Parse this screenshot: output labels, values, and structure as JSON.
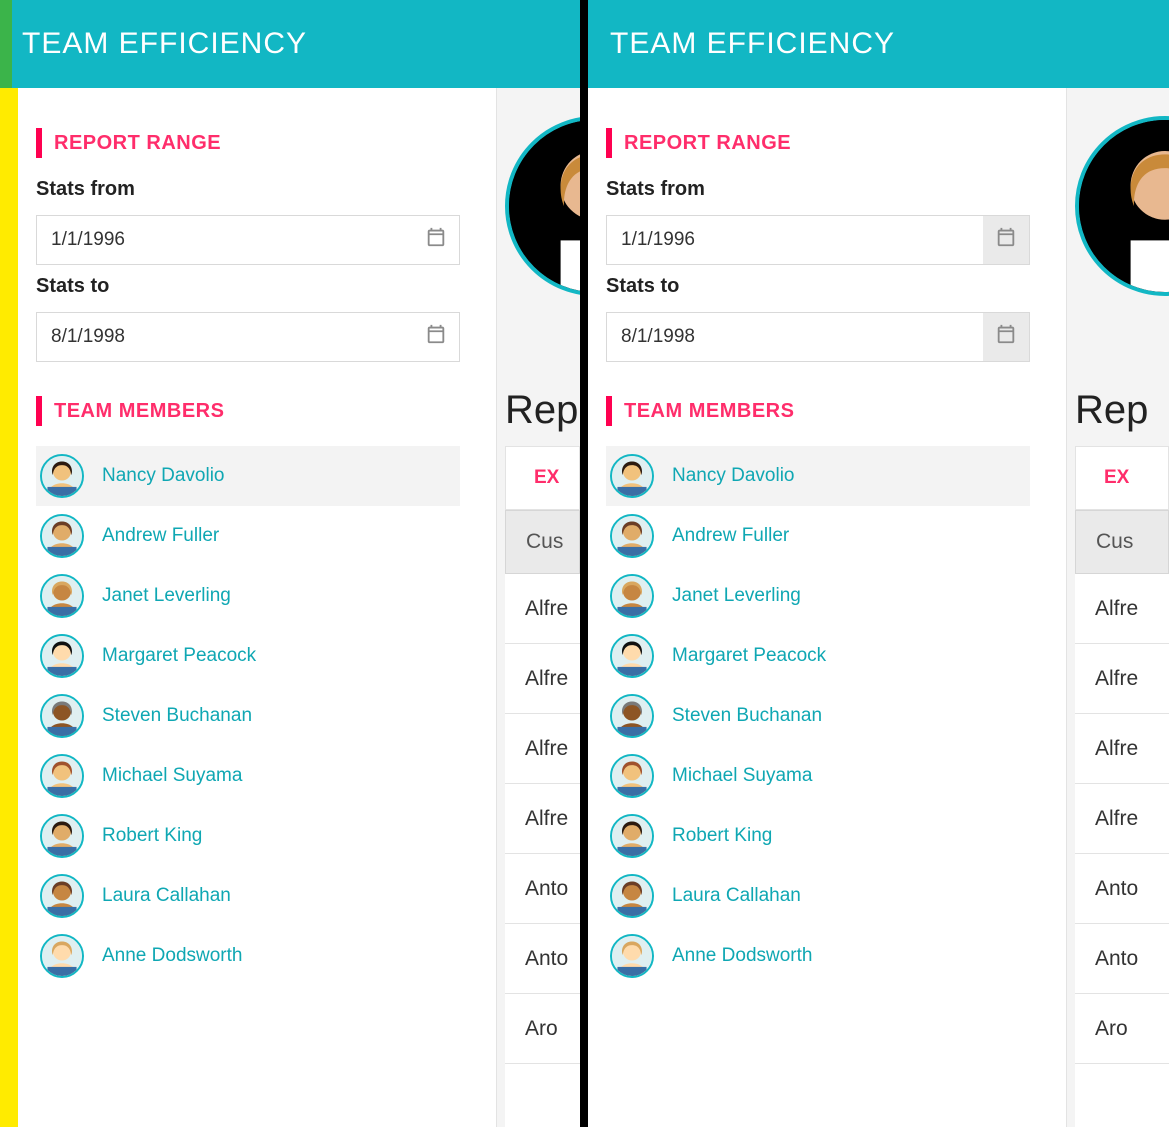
{
  "header": {
    "title": "TEAM EFFICIENCY"
  },
  "report_range": {
    "section_label": "REPORT RANGE",
    "from_label": "Stats from",
    "from_value": "1/1/1996",
    "to_label": "Stats to",
    "to_value": "8/1/1998"
  },
  "team": {
    "section_label": "TEAM MEMBERS",
    "selected_index": 0,
    "members": [
      {
        "name": "Nancy Davolio"
      },
      {
        "name": "Andrew Fuller"
      },
      {
        "name": "Janet Leverling"
      },
      {
        "name": "Margaret Peacock"
      },
      {
        "name": "Steven Buchanan"
      },
      {
        "name": "Michael Suyama"
      },
      {
        "name": "Robert King"
      },
      {
        "name": "Laura Callahan"
      },
      {
        "name": "Anne Dodsworth"
      }
    ]
  },
  "content": {
    "heading_fragment": "Rep",
    "tab_fragment_left": "EX",
    "tab_fragment_right": "EX",
    "grid_header_fragment": "Cus",
    "rows": [
      "Alfre",
      "Alfre",
      "Alfre",
      "Alfre",
      "Anto",
      "Anto",
      "Aro"
    ]
  },
  "colors": {
    "teal": "#12b7c4",
    "pink": "#ff2d6b",
    "accent_green": "#3bb44a",
    "accent_yellow": "#ffeb00"
  }
}
